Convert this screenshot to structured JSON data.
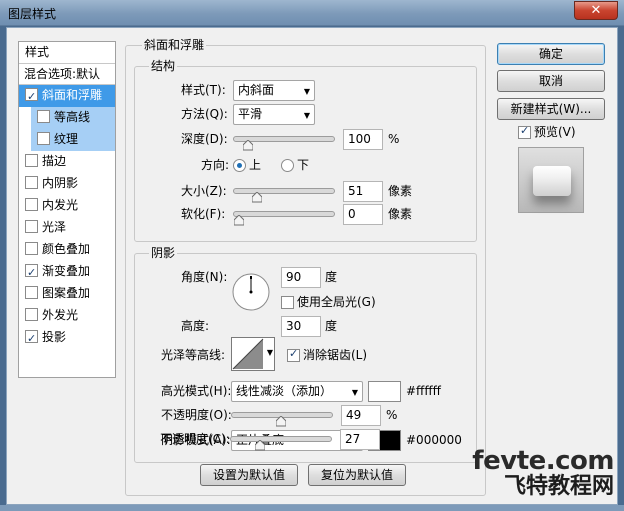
{
  "window": {
    "title": "图层样式",
    "close_glyph": "✕"
  },
  "stylelist": {
    "header": "样式",
    "blend_options": "混合选项:默认",
    "items": [
      {
        "label": "斜面和浮雕",
        "checked": true
      },
      {
        "label": "等高线",
        "checked": false
      },
      {
        "label": "纹理",
        "checked": false
      },
      {
        "label": "描边",
        "checked": false
      },
      {
        "label": "内阴影",
        "checked": false
      },
      {
        "label": "内发光",
        "checked": false
      },
      {
        "label": "光泽",
        "checked": false
      },
      {
        "label": "颜色叠加",
        "checked": false
      },
      {
        "label": "渐变叠加",
        "checked": true
      },
      {
        "label": "图案叠加",
        "checked": false
      },
      {
        "label": "外发光",
        "checked": false
      },
      {
        "label": "投影",
        "checked": true
      }
    ]
  },
  "bevel": {
    "section_title": "斜面和浮雕",
    "structure": {
      "title": "结构",
      "style_label": "样式(T):",
      "style_value": "内斜面",
      "method_label": "方法(Q):",
      "method_value": "平滑",
      "depth_label": "深度(D):",
      "depth_value": "100",
      "depth_unit": "%",
      "depth_slider": 0.1,
      "direction_label": "方向:",
      "dir_up": "上",
      "dir_down": "下",
      "direction_value": "上",
      "size_label": "大小(Z):",
      "size_value": "51",
      "size_unit": "像素",
      "size_slider": 0.2,
      "soften_label": "软化(F):",
      "soften_value": "0",
      "soften_unit": "像素",
      "soften_slider": 0.0
    },
    "shading": {
      "title": "阴影",
      "angle_label": "角度(N):",
      "angle_value": "90",
      "angle_unit": "度",
      "global_light_label": "使用全局光(G)",
      "global_light_checked": false,
      "altitude_label": "高度:",
      "altitude_value": "30",
      "altitude_unit": "度",
      "gloss_contour_label": "光泽等高线:",
      "anti_alias_label": "消除锯齿(L)",
      "anti_alias_checked": true,
      "highlight_mode_label": "高光模式(H):",
      "highlight_mode_value": "线性减淡（添加）",
      "highlight_color": "#ffffff",
      "highlight_color_text": "#ffffff",
      "highlight_opacity_label": "不透明度(O):",
      "highlight_opacity_value": "49",
      "highlight_opacity_unit": "%",
      "highlight_opacity_slider": 0.49,
      "shadow_mode_label": "阴影模式(A):",
      "shadow_mode_value": "正片叠底",
      "shadow_color": "#000000",
      "shadow_color_text": "#000000",
      "shadow_opacity_label": "不透明度(C):",
      "shadow_opacity_value": "27",
      "shadow_opacity_unit": "%",
      "shadow_opacity_slider": 0.27
    },
    "make_default": "设置为默认值",
    "reset_default": "复位为默认值"
  },
  "buttons": {
    "ok": "确定",
    "cancel": "取消",
    "new_style": "新建样式(W)...",
    "preview_label": "预览(V)",
    "preview_checked": true
  },
  "watermark": {
    "top": "fevte.com",
    "bottom": "飞特教程网"
  }
}
